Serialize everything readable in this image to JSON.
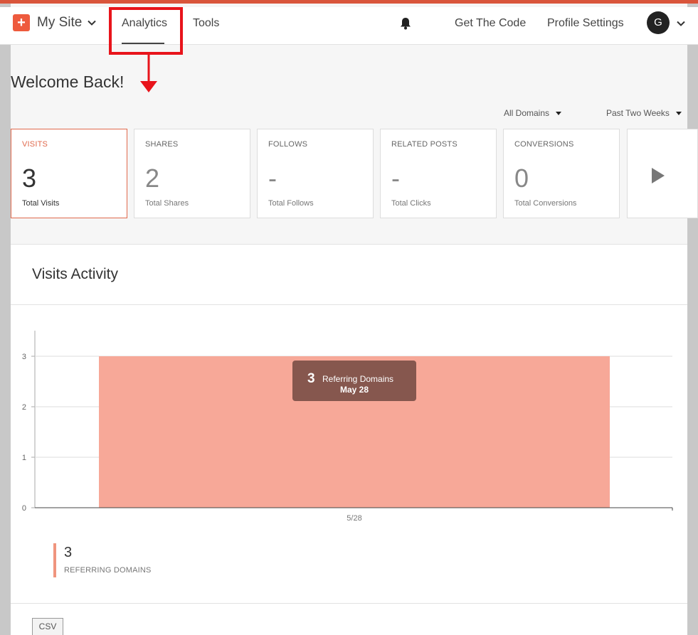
{
  "navbar": {
    "brand_name": "My Site",
    "tabs": [
      {
        "label": "Analytics",
        "active": true
      },
      {
        "label": "Tools",
        "active": false
      }
    ],
    "get_code": "Get The Code",
    "profile_settings": "Profile Settings",
    "avatar_letter": "G"
  },
  "welcome": "Welcome Back!",
  "filters": {
    "domains": "All Domains",
    "range": "Past Two Weeks"
  },
  "stats": [
    {
      "title": "VISITS",
      "value": "3",
      "sub": "Total Visits",
      "active": true
    },
    {
      "title": "SHARES",
      "value": "2",
      "sub": "Total Shares",
      "active": false
    },
    {
      "title": "FOLLOWS",
      "value": "-",
      "sub": "Total Follows",
      "active": false
    },
    {
      "title": "RELATED POSTS",
      "value": "-",
      "sub": "Total Clicks",
      "active": false
    },
    {
      "title": "CONVERSIONS",
      "value": "0",
      "sub": "Total Conversions",
      "active": false
    }
  ],
  "panel": {
    "title": "Visits Activity"
  },
  "chart_data": {
    "type": "area",
    "x": [
      "5/28"
    ],
    "series": [
      {
        "name": "Referring Domains",
        "values": [
          3
        ]
      }
    ],
    "ylim": [
      0,
      3
    ],
    "yticks": [
      0,
      1,
      2,
      3
    ],
    "tooltip": {
      "value": "3",
      "label": "Referring Domains",
      "date": "May 28"
    },
    "color": "#f7a898"
  },
  "legend": {
    "value": "3",
    "label": "REFERRING DOMAINS"
  },
  "csv_label": "CSV",
  "colors": {
    "accent": "#ee5a3d",
    "highlight": "#e8141b"
  }
}
